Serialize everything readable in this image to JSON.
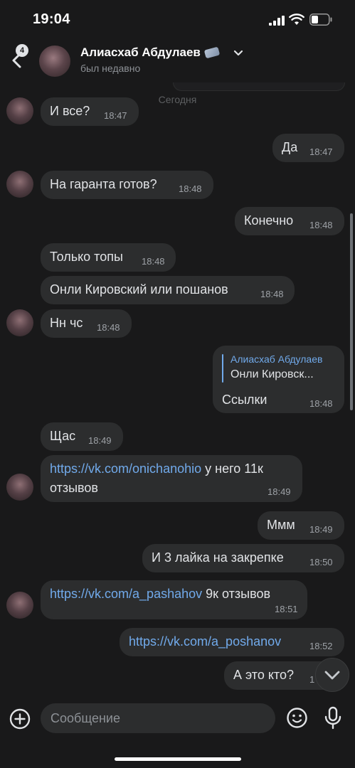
{
  "status_bar": {
    "time": "19:04"
  },
  "header": {
    "back_badge": "4",
    "name": "Алиасхаб Абдулаев",
    "status": "был недавно"
  },
  "chat": {
    "date_separator": "Сегодня",
    "messages": [
      {
        "from": "them",
        "text": "И все?",
        "time": "18:47"
      },
      {
        "from": "me",
        "text": "Да",
        "time": "18:47"
      },
      {
        "from": "them",
        "text": "На гаранта готов?",
        "time": "18:48"
      },
      {
        "from": "me",
        "text": "Конечно",
        "time": "18:48"
      },
      {
        "from": "them",
        "text": "Только топы",
        "time": "18:48"
      },
      {
        "from": "them",
        "text": "Онли Кировский или пошанов",
        "time": "18:48"
      },
      {
        "from": "them",
        "text": "Нн чс",
        "time": "18:48"
      },
      {
        "from": "me",
        "reply_name": "Алиасхаб Абдулаев",
        "reply_text": "Онли Кировск...",
        "text": "Ссылки",
        "time": "18:48"
      },
      {
        "from": "them",
        "text": "Щас",
        "time": "18:49"
      },
      {
        "from": "them",
        "link": "https://vk.com/onichanohio",
        "text_after": "у него 11к",
        "text_line2": "отзывов",
        "time": "18:49"
      },
      {
        "from": "me",
        "text": "Ммм",
        "time": "18:49"
      },
      {
        "from": "me",
        "text": "И 3 лайка на закрепке",
        "time": "18:50"
      },
      {
        "from": "them",
        "link": "https://vk.com/a_pashahov",
        "text_after": "9к отзывов",
        "time": "18:51"
      },
      {
        "from": "me",
        "link": "https://vk.com/a_poshanov",
        "time": "18:52"
      },
      {
        "from": "me",
        "text": "А это кто?",
        "time": "1"
      }
    ]
  },
  "composer": {
    "placeholder": "Сообщение"
  },
  "colors": {
    "background": "#19191a",
    "bubble": "#2c2d2e",
    "link": "#71aaeb",
    "text": "#e1e3e6",
    "muted": "#8d9196"
  }
}
